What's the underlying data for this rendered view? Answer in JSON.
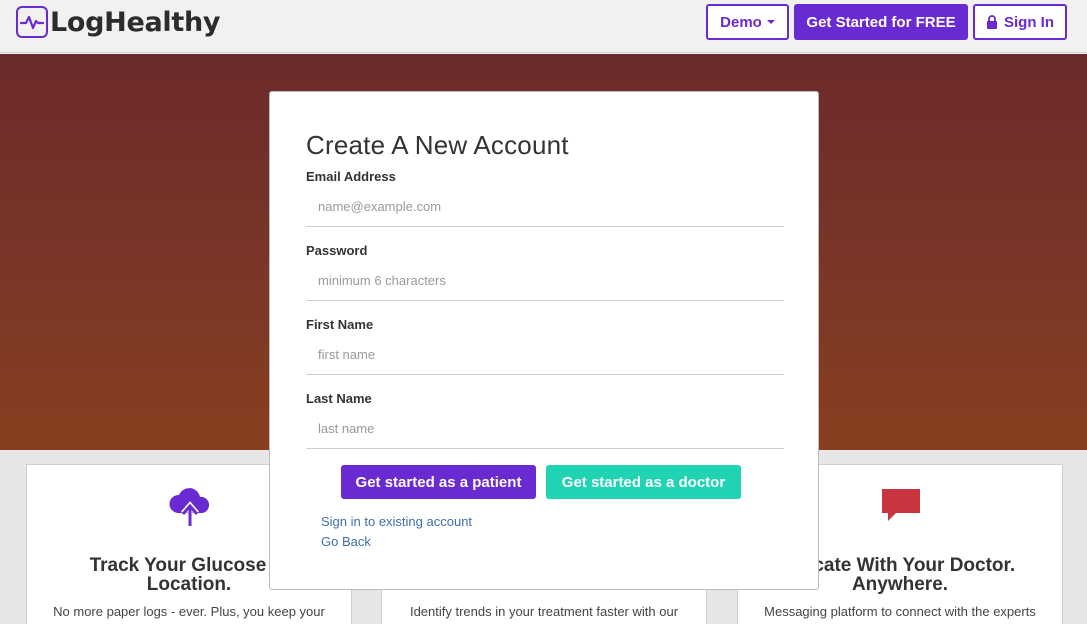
{
  "brand": {
    "name": "LogHealthy",
    "icon": "pulse-logo-icon",
    "color": "#6a2ad1"
  },
  "nav": {
    "demo_label": "Demo",
    "get_started_label": "Get Started for FREE",
    "signin_label": "Sign In"
  },
  "hero": {
    "gradient_top": "#6b2a2b",
    "gradient_bottom": "#883f1f"
  },
  "features": [
    {
      "icon": "cloud-upload-icon",
      "title_line1": "Track Your Glucose in",
      "title_line2": "Location.",
      "text": "No more paper logs - ever. Plus, you keep your"
    },
    {
      "icon": "",
      "title_line1": "",
      "title_line2": "",
      "text": "Identify trends in your treatment faster with our"
    },
    {
      "icon": "chat-bubble-icon",
      "title_line1": "unicate With Your Doctor.",
      "title_line2": "Anywhere.",
      "text": "Messaging platform to connect with the experts"
    }
  ],
  "modal": {
    "title": "Create A New Account",
    "fields": [
      {
        "label": "Email Address",
        "placeholder": "name@example.com",
        "value": ""
      },
      {
        "label": "Password",
        "placeholder": "minimum 6 characters",
        "value": ""
      },
      {
        "label": "First Name",
        "placeholder": "first name",
        "value": ""
      },
      {
        "label": "Last Name",
        "placeholder": "last name",
        "value": ""
      }
    ],
    "patient_button": "Get started as a patient",
    "doctor_button": "Get started as a doctor",
    "signin_link": "Sign in to existing account",
    "back_link": "Go Back"
  },
  "colors": {
    "primary": "#6a2ad1",
    "teal": "#1fd3b3",
    "link": "#3f6fa8",
    "chat": "#c9353f"
  }
}
